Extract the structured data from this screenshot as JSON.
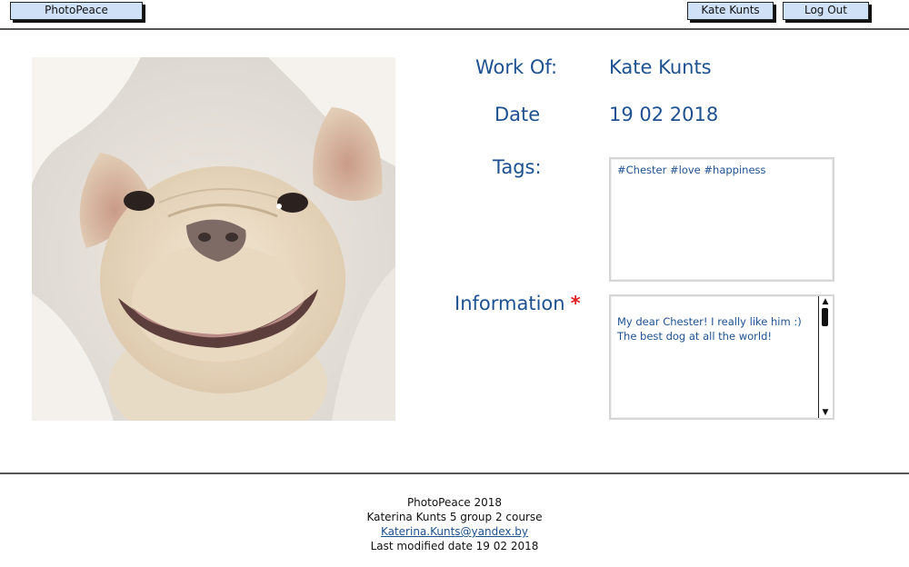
{
  "header": {
    "app_button": "PhotoPeace",
    "user_button": "Kate Kunts",
    "logout_button": "Log Out"
  },
  "details": {
    "work_of_label": "Work Of:",
    "work_of_value": "Kate Kunts",
    "date_label": "Date",
    "date_value": "19 02 2018",
    "tags_label": "Tags:",
    "tags_value": "#Chester #love #happiness",
    "info_label": "Information",
    "info_required_mark": "*",
    "info_value": "My dear Chester! I really like him :)\nThe best dog at all the world!"
  },
  "photo": {
    "subject": "smiling french bulldog"
  },
  "scrollbar": {
    "up_arrow": "▲",
    "down_arrow": "▼"
  },
  "footer": {
    "line1": "PhotoPeace 2018",
    "line2": "Katerina Kunts 5 group 2 course",
    "email": "Katerina.Kunts@yandex.by",
    "line4": "Last modified date 19 02 2018"
  },
  "colors": {
    "accent": "#1d5190",
    "required": "#e02020",
    "button_fill": "#cfe1f7"
  }
}
